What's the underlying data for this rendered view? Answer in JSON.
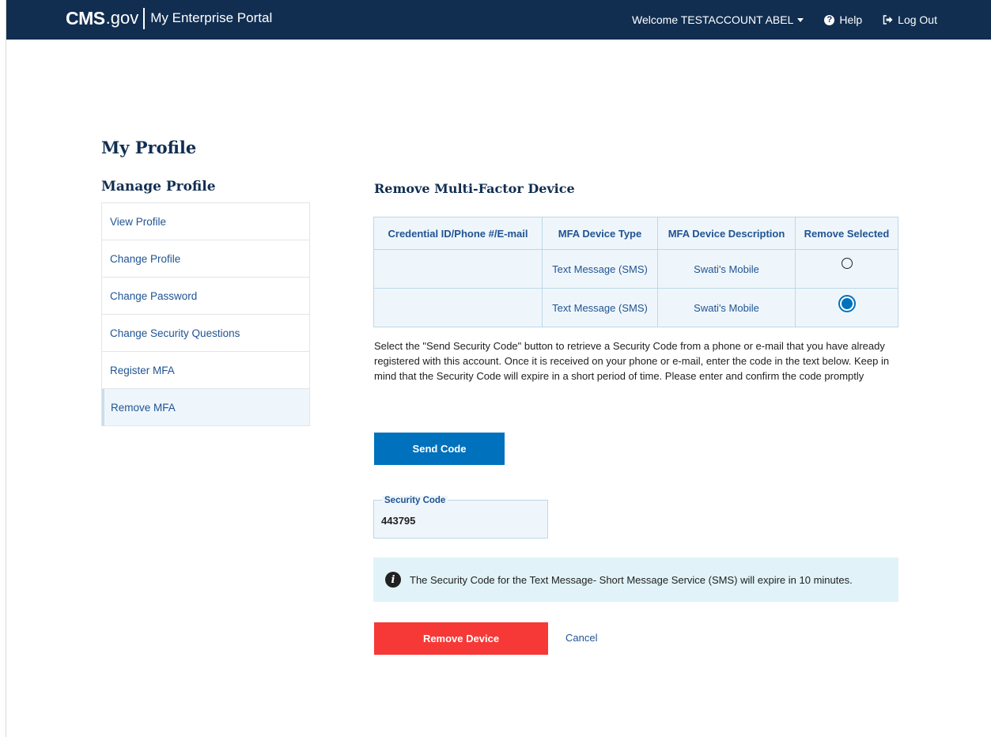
{
  "header": {
    "brand_cms": "CMS",
    "brand_gov": ".gov",
    "brand_portal": "My Enterprise Portal",
    "welcome": "Welcome TESTACCOUNT ABEL",
    "help": "Help",
    "logout": "Log Out"
  },
  "page": {
    "title": "My Profile"
  },
  "sidebar": {
    "title": "Manage Profile",
    "items": [
      {
        "label": "View Profile"
      },
      {
        "label": "Change Profile"
      },
      {
        "label": "Change Password"
      },
      {
        "label": "Change Security Questions"
      },
      {
        "label": "Register MFA"
      },
      {
        "label": "Remove MFA",
        "active": true
      }
    ]
  },
  "main": {
    "title": "Remove Multi-Factor Device",
    "table": {
      "headers": [
        "Credential ID/Phone #/E-mail",
        "MFA Device Type",
        "MFA Device Description",
        "Remove Selected"
      ],
      "rows": [
        {
          "credential": "",
          "type": "Text Message (SMS)",
          "description": "Swati's Mobile",
          "selected": false
        },
        {
          "credential": "",
          "type": "Text Message (SMS)",
          "description": "Swati's Mobile",
          "selected": true
        }
      ]
    },
    "instructions": "Select the \"Send Security Code\" button to retrieve a Security Code from a phone or e-mail that you have already registered with this account. Once it is received on your phone or e-mail, enter the code in the text below. Keep in mind that the Security Code will expire in a short period of time. Please enter and confirm the code promptly",
    "send_button": "Send Code",
    "security_code": {
      "label": "Security Code",
      "value": "443795"
    },
    "alert": {
      "icon": "info-icon",
      "text": "The Security Code for the Text Message- Short Message Service (SMS) will expire in 10 minutes."
    },
    "remove_button": "Remove Device",
    "cancel_link": "Cancel"
  },
  "colors": {
    "header_bg": "#112e51",
    "primary": "#0071bc",
    "danger": "#f63937",
    "link": "#205493",
    "alert_bg": "#e1f3f8"
  }
}
